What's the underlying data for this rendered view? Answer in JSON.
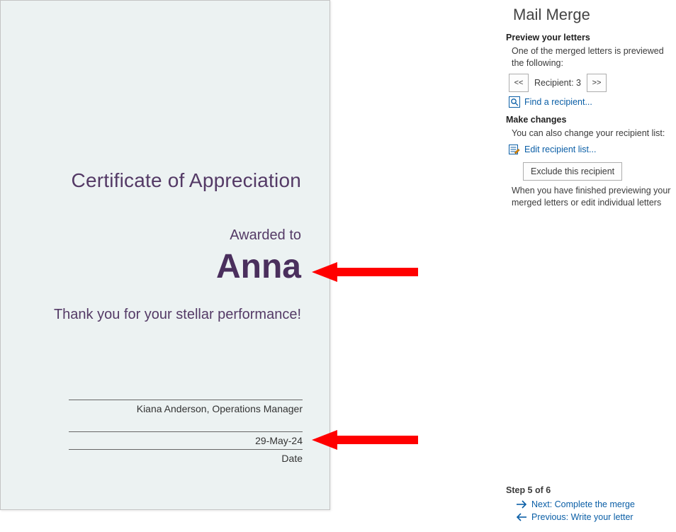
{
  "certificate": {
    "title": "Certificate of Appreciation",
    "awarded_to": "Awarded to",
    "name": "Anna",
    "thanks": "Thank you for your stellar performance!",
    "signer": "Kiana Anderson, Operations Manager",
    "date": "29-May-24",
    "date_label": "Date"
  },
  "panel": {
    "title": "Mail Merge",
    "preview_heading": "Preview your letters",
    "preview_text1": "One of the merged letters is previewed",
    "preview_text2": "the following:",
    "prev_btn": "<<",
    "recipient_label": "Recipient: 3",
    "next_btn": ">>",
    "find_recipient": "Find a recipient...",
    "make_changes_heading": "Make changes",
    "make_changes_text": "You can also change your recipient list:",
    "edit_list": "Edit recipient list...",
    "exclude": "Exclude this recipient",
    "finished_text1": "When you have finished previewing your",
    "finished_text2": "merged letters or edit individual letters",
    "step_label": "Step 5 of 6",
    "next_step": "Next: Complete the merge",
    "prev_step": "Previous: Write your letter"
  }
}
